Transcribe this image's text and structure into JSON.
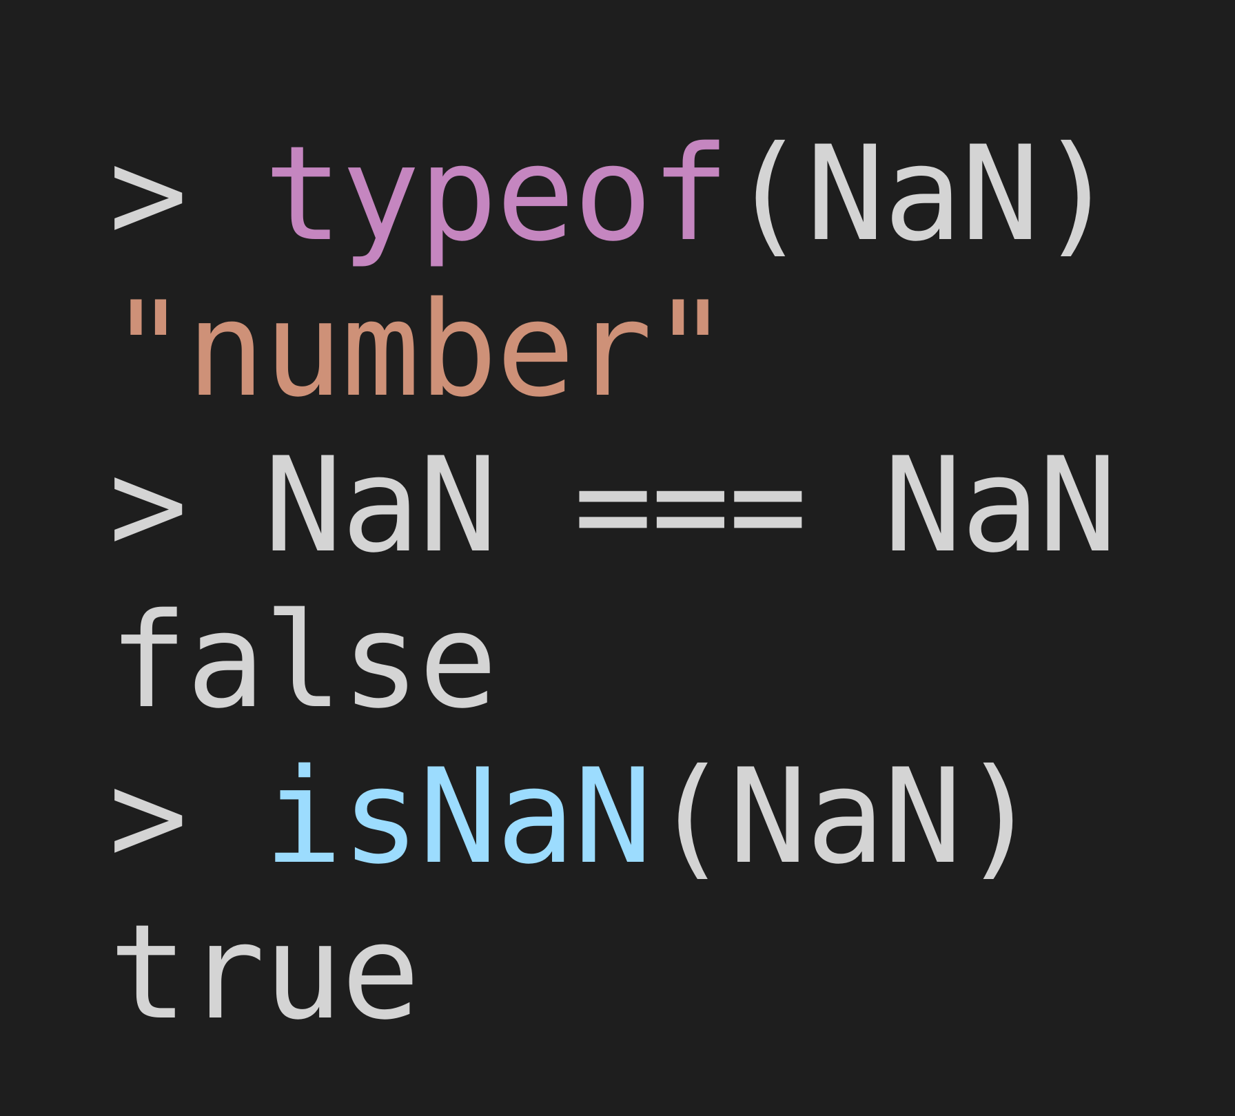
{
  "colors": {
    "background": "#1e1e1e",
    "default_text": "#d4d4d4",
    "keyword": "#c586c0",
    "function": "#9cdcfe",
    "string": "#ce9178"
  },
  "console": {
    "lines": [
      {
        "prompt": ">",
        "keyword": "typeof",
        "rest": "(NaN)"
      },
      {
        "output": "\"number\""
      },
      {
        "prompt": ">",
        "code": "NaN === NaN"
      },
      {
        "output": "false"
      },
      {
        "prompt": ">",
        "function": "isNaN",
        "rest": "(NaN)"
      },
      {
        "output": "true"
      }
    ]
  }
}
